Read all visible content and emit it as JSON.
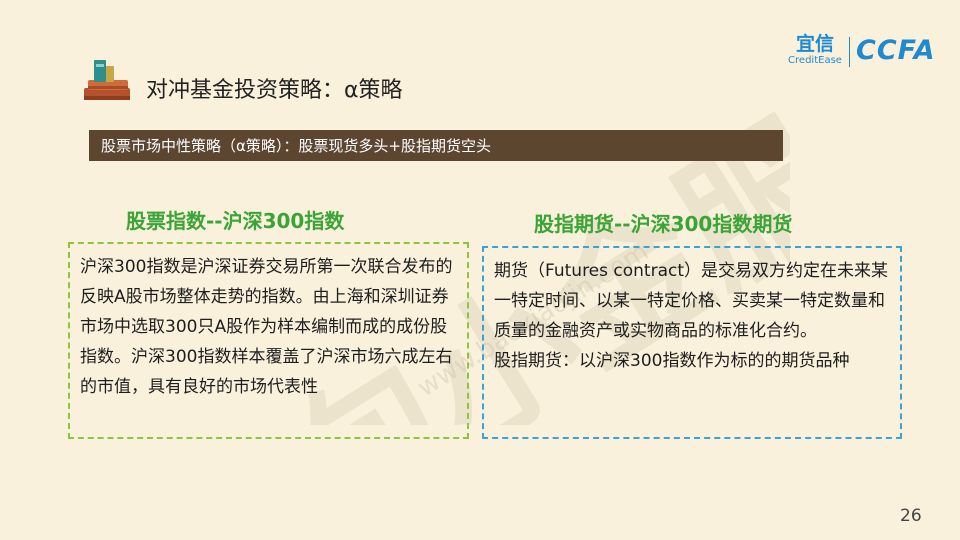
{
  "header": {
    "title": "对冲基金投资策略：α策略",
    "icon": "books-icon"
  },
  "logo": {
    "brand_cn": "宜信",
    "brand_en": "CreditEase",
    "brand_ccfa": "CCFA"
  },
  "subtitle": "股票市场中性策略（α策略）：股票现货多头+股指期货空头",
  "left_section": {
    "heading": "股票指数--沪深300指数",
    "paragraphs": [
      "沪深300指数是沪深证券交易所第一次联合发布的反映A股市场整体走势的指数。由上海和深圳证券市场中选取300只A股作为样本编制而成的成份股指数。沪深300指数样本覆盖了沪深市场六成左右的市值，具有良好的市场代表性"
    ]
  },
  "right_section": {
    "heading": "股指期货--沪深300指数期货",
    "paragraphs": [
      "期货（Futures contract）是交易双方约定在未来某一特定时间、以某一特定价格、买卖某一特定数量和质量的金融资产或实物商品的标准化合约。",
      "股指期货：以沪深300指数作为标的的期货品种"
    ]
  },
  "watermark": {
    "main": "包小金服",
    "small": "www.baoxiaojin.com"
  },
  "page_number": "26",
  "colors": {
    "background": "#f9f1dc",
    "subtitle_bar": "#5c4630",
    "heading_green": "#3aa435",
    "left_border": "#8cc63f",
    "right_border": "#3aa3d6",
    "logo_blue": "#1f8ad0"
  }
}
